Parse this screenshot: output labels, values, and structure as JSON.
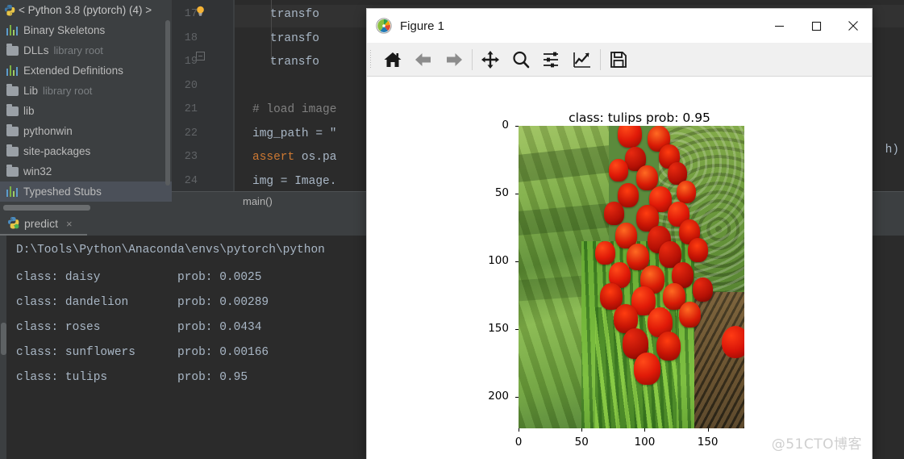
{
  "ide": {
    "project_panel": {
      "header": {
        "label": "< Python 3.8 (pytorch) (4) >",
        "icon": "python-icon"
      },
      "items": [
        {
          "label": "Binary Skeletons",
          "sub": "",
          "icon": "bars-icon",
          "selected": false
        },
        {
          "label": "DLLs",
          "sub": "library root",
          "icon": "folder-icon",
          "selected": false
        },
        {
          "label": "Extended Definitions",
          "sub": "",
          "icon": "bars-icon",
          "selected": false
        },
        {
          "label": "Lib",
          "sub": "library root",
          "icon": "folder-icon",
          "selected": false
        },
        {
          "label": "lib",
          "sub": "",
          "icon": "folder-icon",
          "selected": false
        },
        {
          "label": "pythonwin",
          "sub": "",
          "icon": "folder-icon",
          "selected": false
        },
        {
          "label": "site-packages",
          "sub": "",
          "icon": "folder-icon",
          "selected": false
        },
        {
          "label": "win32",
          "sub": "",
          "icon": "folder-icon",
          "selected": false
        },
        {
          "label": "Typeshed Stubs",
          "sub": "",
          "icon": "bars-icon",
          "selected": true
        }
      ]
    },
    "editor": {
      "line_numbers": [
        "17",
        "18",
        "19",
        "20",
        "21",
        "22",
        "23",
        "24"
      ],
      "lines": [
        {
          "text": "transfo",
          "kind": "plain"
        },
        {
          "text": "transfo",
          "kind": "plain"
        },
        {
          "text": "transfo",
          "kind": "plain"
        },
        {
          "text": "",
          "kind": "plain"
        },
        {
          "text": "# load image",
          "kind": "comment"
        },
        {
          "text": "img_path = \"",
          "kind": "plain"
        },
        {
          "text": "assert os.pa",
          "kind": "keyword-lead"
        },
        {
          "text": "img = Image.",
          "kind": "plain"
        }
      ],
      "right_fragment": "h)"
    },
    "breadcrumb": {
      "label": "main()"
    },
    "console": {
      "tab_label": "predict",
      "tab_icon": "python-run-icon",
      "tab_close": "×",
      "command_line": "D:\\Tools\\Python\\Anaconda\\envs\\pytorch\\python",
      "results": [
        {
          "class_label": "class: daisy",
          "prob_label": "prob: 0.0025"
        },
        {
          "class_label": "class: dandelion",
          "prob_label": "prob: 0.00289"
        },
        {
          "class_label": "class: roses",
          "prob_label": "prob: 0.0434"
        },
        {
          "class_label": "class: sunflowers",
          "prob_label": "prob: 0.00166"
        },
        {
          "class_label": "class: tulips",
          "prob_label": "prob: 0.95"
        }
      ]
    }
  },
  "figure_window": {
    "title": "Figure 1",
    "icon": "matplotlib-icon",
    "window_buttons": [
      {
        "name": "minimize",
        "glyph": "—"
      },
      {
        "name": "maximize",
        "glyph": "□"
      },
      {
        "name": "close",
        "glyph": "✕"
      }
    ],
    "toolbar": [
      {
        "name": "home-icon",
        "tooltip": "Home"
      },
      {
        "name": "back-arrow-icon",
        "tooltip": "Back"
      },
      {
        "name": "forward-arrow-icon",
        "tooltip": "Forward"
      },
      {
        "name": "pan-move-icon",
        "tooltip": "Pan"
      },
      {
        "name": "zoom-magnifier-icon",
        "tooltip": "Zoom to rectangle"
      },
      {
        "name": "subplot-sliders-icon",
        "tooltip": "Configure subplots"
      },
      {
        "name": "edit-curve-icon",
        "tooltip": "Edit axis, curve and image parameters"
      },
      {
        "name": "save-floppy-icon",
        "tooltip": "Save the figure"
      }
    ]
  },
  "chart_data": {
    "type": "heatmap",
    "title": "class: tulips   prob: 0.95",
    "xlabel": "",
    "ylabel": "",
    "xlim": [
      0,
      179
    ],
    "ylim": [
      223,
      0
    ],
    "xticks": [
      "0",
      "50",
      "100",
      "150"
    ],
    "xtick_values": [
      0,
      50,
      100,
      150
    ],
    "yticks": [
      "0",
      "50",
      "100",
      "150",
      "200"
    ],
    "ytick_values": [
      0,
      50,
      100,
      150,
      200
    ],
    "grid": false,
    "legend": null,
    "image_subject": "red tulips in a garden bed beside grass lawn",
    "predicted_class": "tulips",
    "probability": 0.95,
    "all_class_probabilities": {
      "daisy": 0.0025,
      "dandelion": 0.00289,
      "roses": 0.0434,
      "sunflowers": 0.00166,
      "tulips": 0.95
    }
  },
  "watermark": {
    "text": "@51CTO博客"
  }
}
